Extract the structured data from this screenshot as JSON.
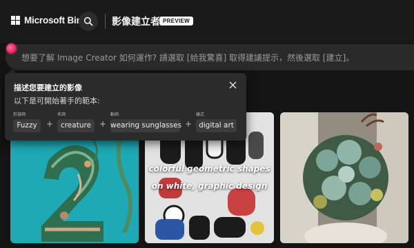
{
  "header": {
    "brand": "Microsoft Bing",
    "title": "影像建立者",
    "badge": "PREVIEW"
  },
  "prompt": {
    "placeholder": "想要了解 Image Creator 如何運作? 請選取 [給我驚喜] 取得建議提示，然後選取 [建立]。"
  },
  "tooltip": {
    "title": "描述您要建立的影像",
    "subtitle": "以下是可開始著手的範本:",
    "chips": [
      {
        "label": "形容詞",
        "value": "Fuzzy"
      },
      {
        "label": "名詞",
        "value": "creature"
      },
      {
        "label": "動詞",
        "value": "wearing sunglasses"
      },
      {
        "label": "樣式",
        "value": "digital art"
      }
    ],
    "plus": "+"
  },
  "gallery": {
    "caption_line1": "colorful geometric shapes",
    "caption_line2": "on white, graphic design"
  },
  "colors": {
    "background": "#141414",
    "accent_dot": "#e0255c",
    "tooltip_bg": "#2b2b2b"
  },
  "icons": [
    "microsoft-logo-icon",
    "search-icon",
    "close-icon"
  ]
}
